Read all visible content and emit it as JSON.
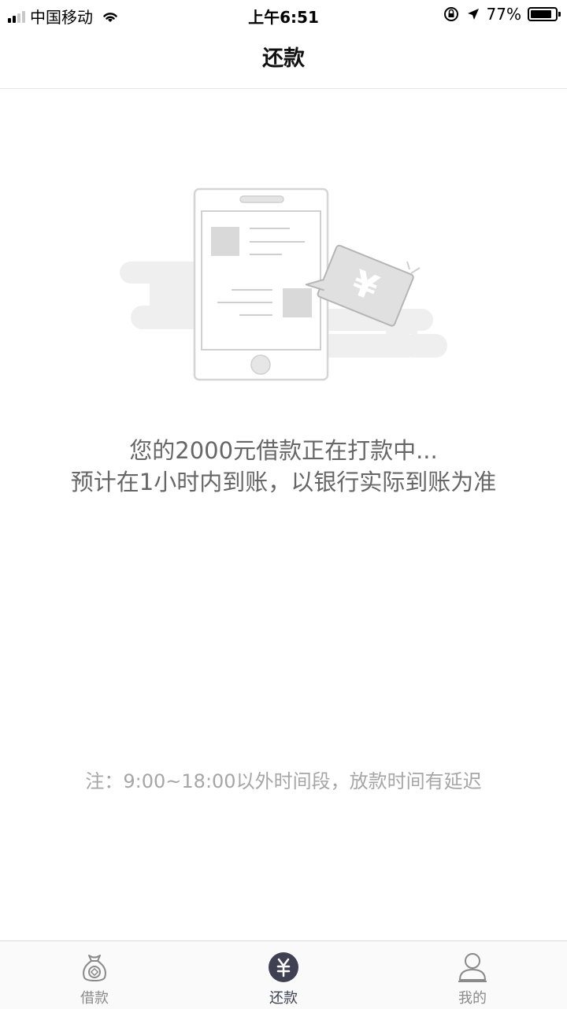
{
  "status_bar": {
    "carrier": "中国移动",
    "time": "上午6:51",
    "battery_percent": "77%",
    "battery_level": 0.77
  },
  "nav": {
    "title": "还款"
  },
  "content": {
    "line1": "您的2000元借款正在打款中...",
    "line2": "预计在1小时内到账，以银行实际到账为准",
    "note": "注：9:00~18:00以外时间段，放款时间有延迟"
  },
  "tabs": [
    {
      "label": "借款",
      "icon": "money-bag-icon",
      "active": false
    },
    {
      "label": "还款",
      "icon": "yen-circle-icon",
      "active": true
    },
    {
      "label": "我的",
      "icon": "user-icon",
      "active": false
    }
  ],
  "colors": {
    "active_tab": "#3f4152",
    "inactive_tab": "#8a8a8a",
    "message_text": "#666666",
    "note_text": "#a6a6a6"
  }
}
